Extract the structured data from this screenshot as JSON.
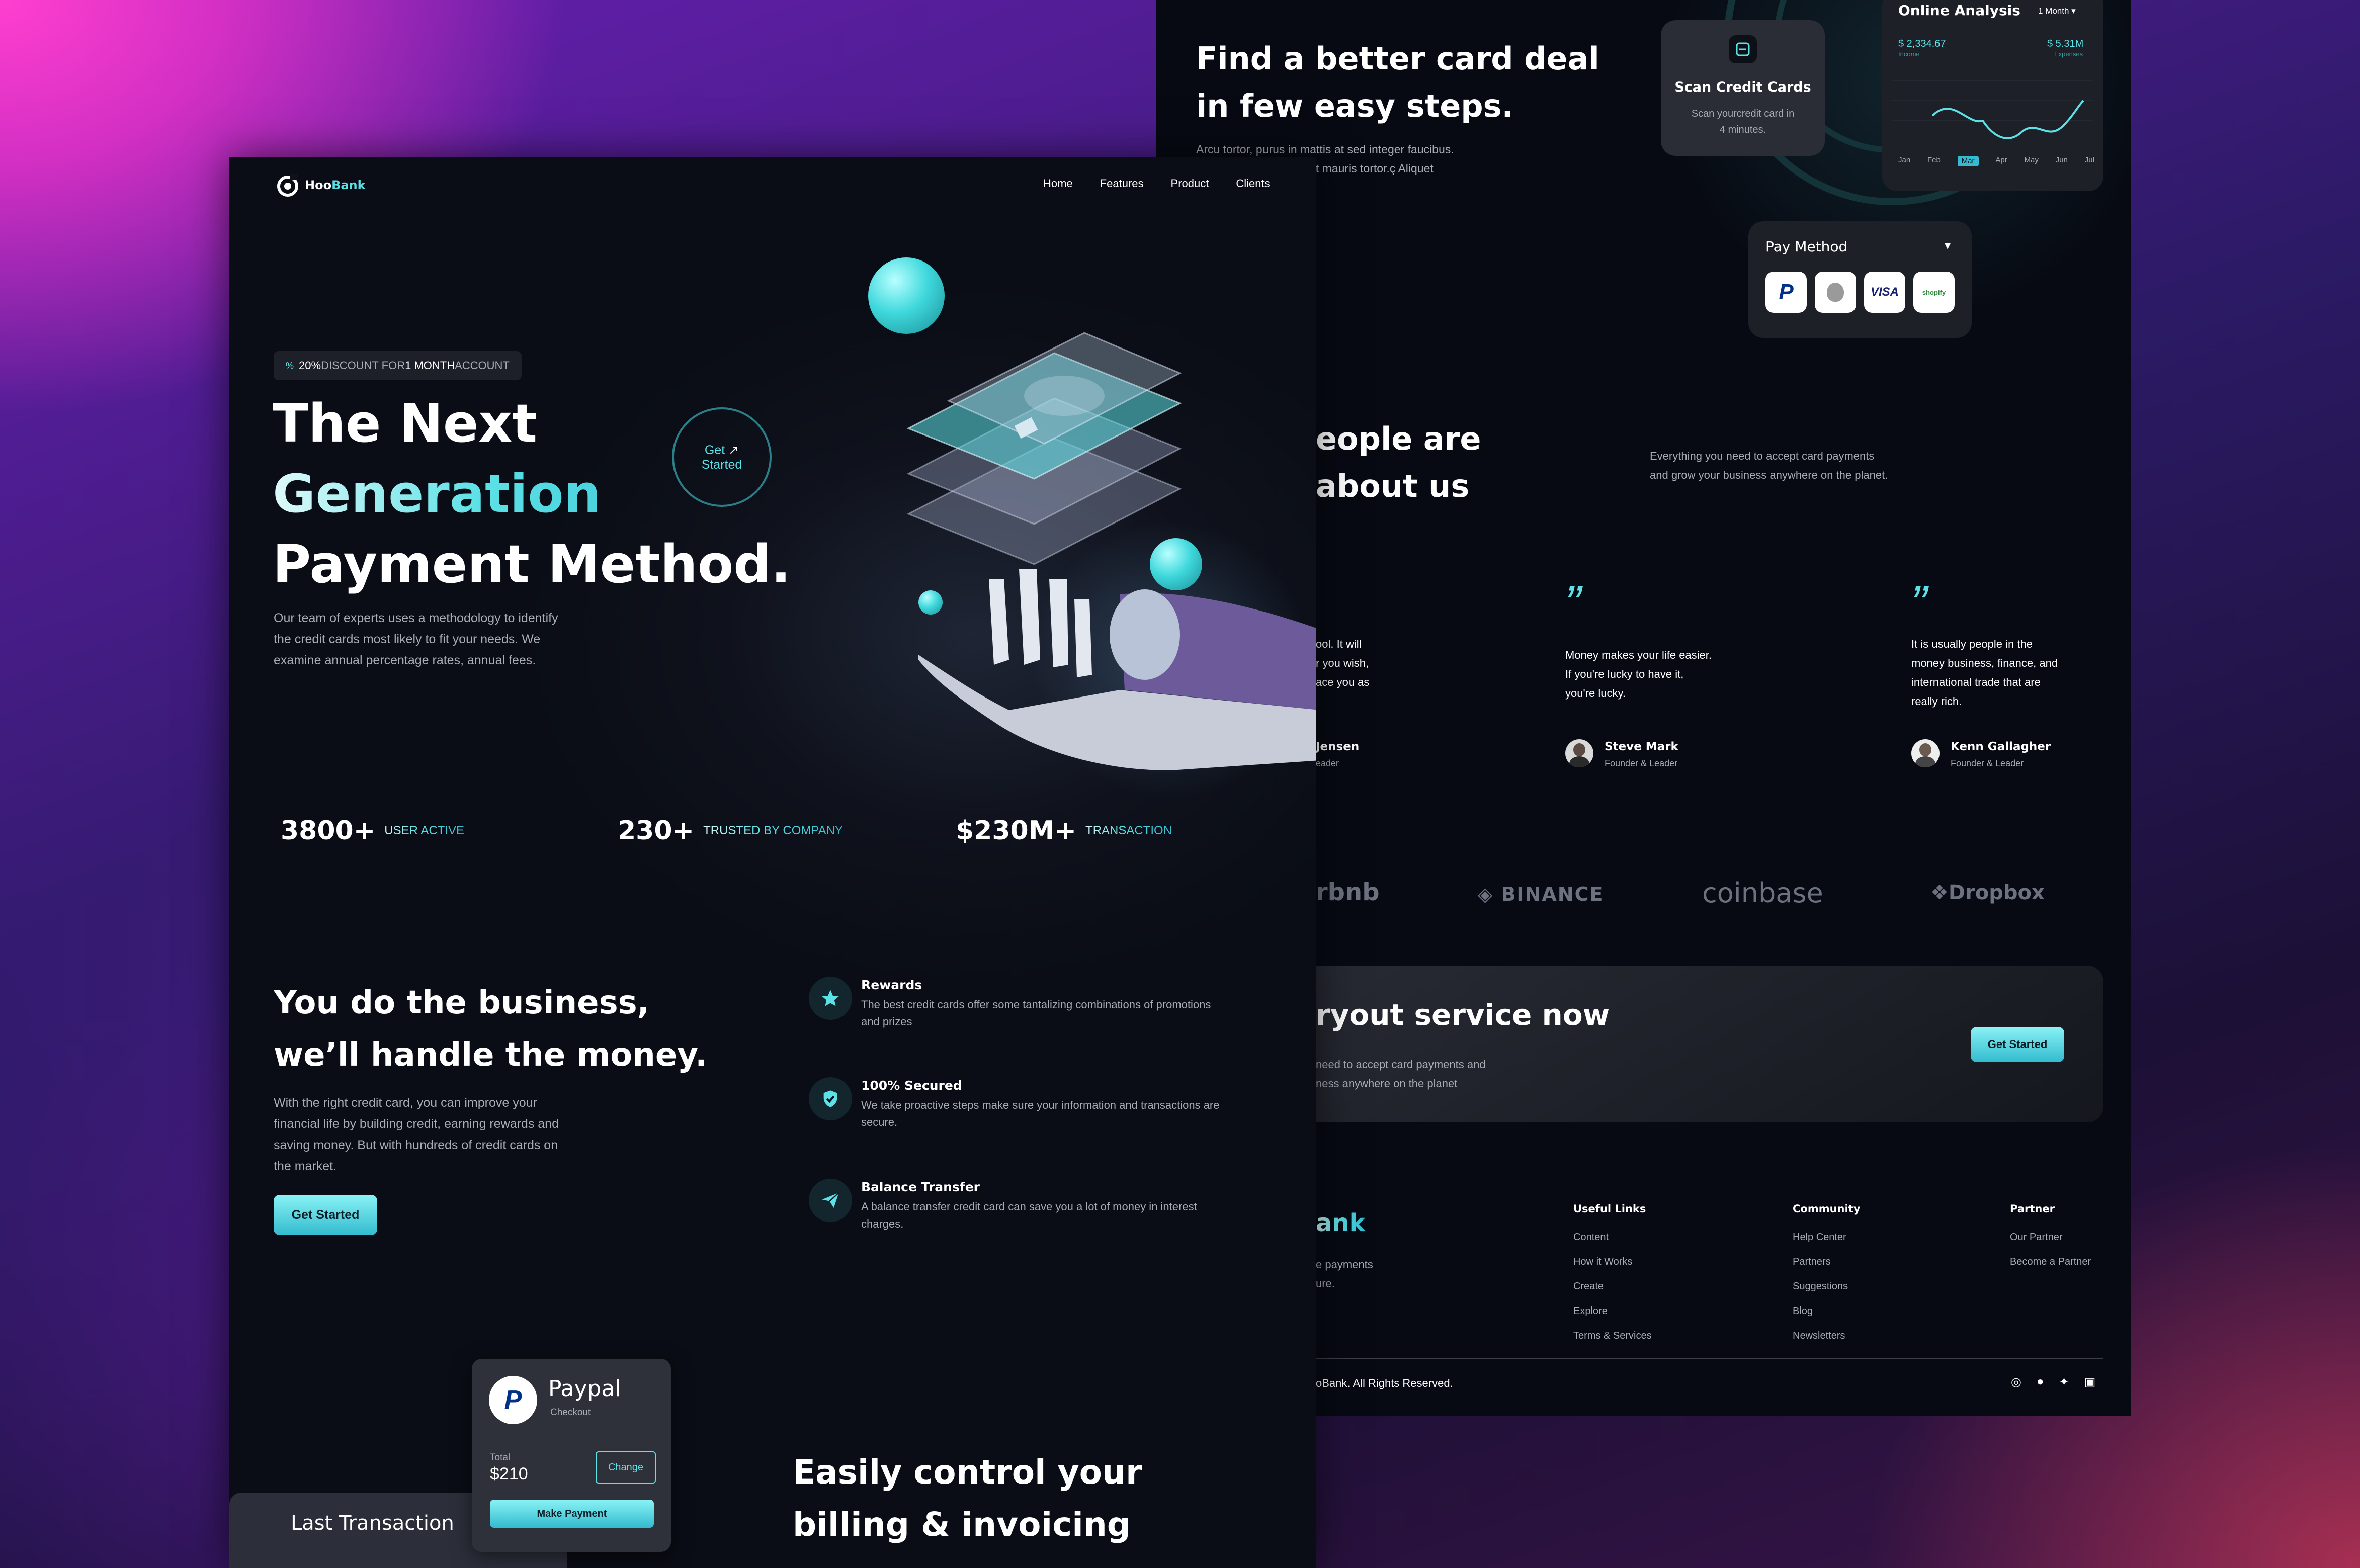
{
  "back": {
    "hero_title_line1": "Find a better card deal",
    "hero_title_line2": "in few easy steps.",
    "hero_desc_line1": "Arcu tortor, purus in mattis at sed integer faucibus.",
    "hero_desc_line2": "Aliquet quis aliquet eget mauris tortor.ç Aliquet",
    "scan_card": {
      "title": "Scan Credit Cards",
      "desc_line1": "Scan yourcredit card in",
      "desc_line2": "4 minutes."
    },
    "analysis": {
      "title": "Online Analysis",
      "period": "1 Month",
      "income_value": "$ 2,334.67",
      "income_label": "Income",
      "expenses_value": "$ 5.31M",
      "expenses_label": "Expenses",
      "months": [
        "Jan",
        "Feb",
        "Mar",
        "Apr",
        "May",
        "Jun",
        "Jul"
      ],
      "active_month": "Mar"
    },
    "pay_method": {
      "title": "Pay Method",
      "logos": [
        "PayPal",
        "",
        "VISA",
        "shopify"
      ]
    },
    "testimonials_title_line1": "eople are",
    "testimonials_title_line2": "about us",
    "testimonials_desc_line1": "Everything you need to accept card payments",
    "testimonials_desc_line2": "and grow your business anywhere on the planet.",
    "testimonial_partial": {
      "line1": "ool. It will",
      "line2": "r you wish,",
      "line3": "ace you as",
      "name": "Jensen",
      "role": "eader"
    },
    "testimonial_2": {
      "quote_mark": "”",
      "line1": "Money makes your life easier.",
      "line2": "If you're lucky to have it,",
      "line3": "you're lucky.",
      "name": "Steve Mark",
      "role": "Founder & Leader"
    },
    "testimonial_3": {
      "quote_mark": "”",
      "line1": "It is usually people in the",
      "line2": "money business, finance, and",
      "line3": "international trade that are",
      "line4": "really rich.",
      "name": "Kenn Gallagher",
      "role": "Founder & Leader"
    },
    "clients": [
      "rbnb",
      "BINANCE",
      "coinbase",
      "Dropbox"
    ],
    "cta": {
      "title": "ryout service now",
      "desc_line1": "need to accept card payments and",
      "desc_line2": "ness anywhere on the planet",
      "button": "Get Started"
    },
    "footer": {
      "brand": "ank",
      "brand_desc_line1": "e payments",
      "brand_desc_line2": "ure.",
      "columns": [
        {
          "title": "Useful Links",
          "links": [
            "Content",
            "How it Works",
            "Create",
            "Explore",
            "Terms & Services"
          ]
        },
        {
          "title": "Community",
          "links": [
            "Help Center",
            "Partners",
            "Suggestions",
            "Blog",
            "Newsletters"
          ]
        },
        {
          "title": "Partner",
          "links": [
            "Our Partner",
            "Become a Partner"
          ]
        }
      ],
      "copyright": "oBank. All Rights Reserved."
    }
  },
  "front": {
    "logo": "HooBank",
    "nav": [
      "Home",
      "Features",
      "Product",
      "Clients"
    ],
    "badge": {
      "highlight1": "20%",
      "text1": " DISCOUNT FOR ",
      "highlight2": "1 MONTH",
      "text2": " ACCOUNT"
    },
    "hero_line1": "The Next",
    "hero_line2": "Generation",
    "hero_line3": "Payment Method.",
    "get_started_circle_line1": "Get",
    "get_started_circle_line2": "Started",
    "hero_desc_line1": "Our team of experts uses a methodology to identify",
    "hero_desc_line2": "the credit cards most likely to fit your needs. We",
    "hero_desc_line3": "examine annual percentage rates, annual fees.",
    "stats": [
      {
        "value": "3800+",
        "label": "USER ACTIVE"
      },
      {
        "value": "230+",
        "label": "TRUSTED BY COMPANY"
      },
      {
        "value": "$230M+",
        "label": "TRANSACTION"
      }
    ],
    "business_title_line1": "You do the business,",
    "business_title_line2": "we’ll handle the money.",
    "business_desc_line1": "With the right credit card, you can improve your",
    "business_desc_line2": "financial life by building credit, earning rewards and",
    "business_desc_line3": "saving money. But with hundreds of credit cards on",
    "business_desc_line4": "the market.",
    "business_button": "Get Started",
    "features": [
      {
        "title": "Rewards",
        "line1": "The best credit cards offer some tantalizing combinations of promotions",
        "line2": "and prizes"
      },
      {
        "title": "100% Secured",
        "line1": "We take proactive steps make sure your information and transactions are",
        "line2": "secure."
      },
      {
        "title": "Balance Transfer",
        "line1": "A balance transfer credit card can save you a lot of money in interest",
        "line2": "charges."
      }
    ],
    "paypal_card": {
      "title": "Paypal",
      "subtitle": "Checkout",
      "total_label": "Total",
      "total_value": "$210",
      "change": "Change",
      "button": "Make Payment"
    },
    "last_transaction": "Last Transaction",
    "billing_line1": "Easily control your",
    "billing_line2": "billing & invoicing"
  }
}
